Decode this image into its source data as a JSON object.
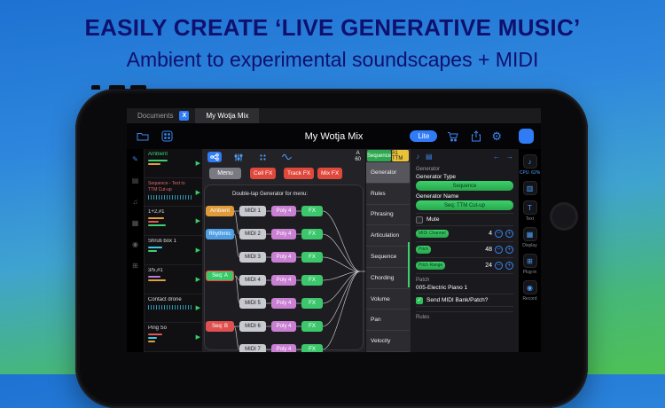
{
  "colors": {
    "accent_blue": "#2f7cf6",
    "green": "#2fbf5a",
    "red": "#e0483c",
    "yellow": "#e8c23a",
    "hero_text": "#10106e",
    "bg_top": "#1e72d2",
    "bg_bottom": "#4fc155"
  },
  "hero": {
    "title": "EASILY CREATE ‘LIVE GENERATIVE MUSIC’",
    "subtitle": "Ambient to experimental soundscapes + MIDI"
  },
  "icons": {
    "gear": "⚙",
    "play": "▶",
    "note": "♪",
    "notes": "♫",
    "pencil": "✎",
    "grid": "▦",
    "rows": "▤",
    "panel": "▥",
    "dot": "◉",
    "plugin": "⊞",
    "check": "✓",
    "minus": "−",
    "plus": "+",
    "back": "←",
    "forward": "→",
    "text": "T",
    "close": "X"
  },
  "app": {
    "tabbar": {
      "documents": "Documents",
      "active": "My Wotja Mix"
    },
    "toolbar": {
      "title": "My Wotja Mix",
      "lite": "Lite"
    },
    "tracks": [
      {
        "name": "Ambient"
      },
      {
        "name": "Sequence - Text to TTM Cut-up"
      },
      {
        "name": "1+2,#1"
      },
      {
        "name": "Shruti box 1"
      },
      {
        "name": "3/5,#1"
      },
      {
        "name": "Contact drone"
      },
      {
        "name": "Ping So"
      }
    ],
    "graph": {
      "counter_top": "A",
      "counter_bottom": "60",
      "menu": "Menu",
      "cell_fx": "Cell FX",
      "track_fx": "Track FX",
      "mix_fx": "Mix FX",
      "hint": "Double-tap Generator for menu:",
      "sources": [
        {
          "label": "Ambient"
        },
        {
          "label": "Rhythmic"
        },
        {
          "label": "Seq: A"
        },
        {
          "label": "Seq: B"
        }
      ],
      "midi": [
        "MIDI 1",
        "MIDI 2",
        "MIDI 3",
        "MIDI 4",
        "MIDI 5",
        "MIDI 6",
        "MIDI 7"
      ],
      "poly": [
        "Poly 4",
        "Poly 4",
        "Poly 4",
        "Poly 4",
        "Poly 4",
        "Poly 4",
        "Poly 4"
      ],
      "fx": [
        "FX",
        "FX",
        "FX",
        "FX",
        "FX",
        "FX",
        "FX"
      ]
    },
    "inspector": {
      "tab_sequence": "Sequence",
      "tab_ttm": "#1 TTM",
      "items": [
        "Generator",
        "Rules",
        "Phrasing",
        "Articulation",
        "Sequence",
        "Chording",
        "Volume",
        "Pan",
        "Velocity"
      ]
    },
    "detail": {
      "section_generator": "Generator",
      "generator_type_label": "Generator Type",
      "generator_type_value": "Sequence",
      "generator_name_label": "Generator Name",
      "generator_name_value": "Seq: TTM Cut-up",
      "mute_label": "Mute",
      "midi_channel_label": "MIDI Channel",
      "midi_channel_value": "4",
      "pitch_label": "Pitch",
      "pitch_value": "48",
      "pitch_range_label": "Pitch Range",
      "pitch_range_value": "24",
      "patch_label": "Patch",
      "patch_value": "005-Electric Piano 1",
      "send_midi_label": "Send MIDI Bank/Patch?",
      "section_rules": "Rules"
    },
    "rail": {
      "cpu": "CPU: 62%",
      "text_label": "Text",
      "display_label": "Display",
      "plugin_label": "Plug-in",
      "record_label": "Record"
    }
  }
}
